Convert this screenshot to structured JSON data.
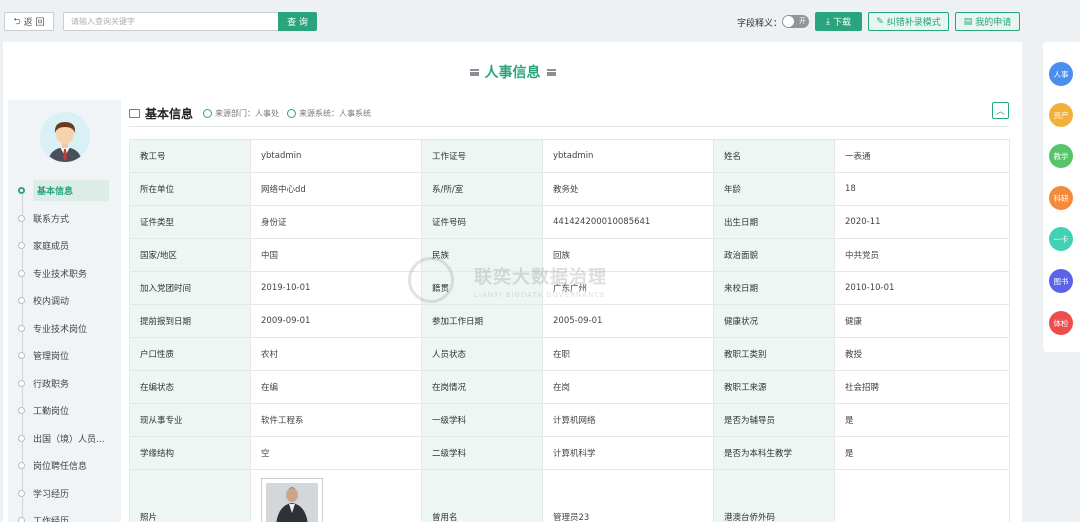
{
  "topbar": {
    "back_label": "返 回",
    "search_placeholder": "请输入查询关键字",
    "search_button": "查 询",
    "field_toggle_label": "字段释义：",
    "toggle_state": "开",
    "download_label": "下载",
    "correct_label": "纠错补录模式",
    "apply_label": "我的申请"
  },
  "page": {
    "title": "人事信息"
  },
  "section": {
    "title": "基本信息",
    "source_dept": "来源部门：人事处",
    "source_sys": "来源系统：人事系统"
  },
  "sidenav": {
    "items": [
      {
        "label": "基本信息",
        "active": true
      },
      {
        "label": "联系方式"
      },
      {
        "label": "家庭成员"
      },
      {
        "label": "专业技术职务"
      },
      {
        "label": "校内调动"
      },
      {
        "label": "专业技术岗位"
      },
      {
        "label": "管理岗位"
      },
      {
        "label": "行政职务"
      },
      {
        "label": "工勤岗位"
      },
      {
        "label": "出国（境）人员..."
      },
      {
        "label": "岗位聘任信息"
      },
      {
        "label": "学习经历"
      },
      {
        "label": "工作经历"
      }
    ]
  },
  "table": {
    "rows": [
      [
        "教工号",
        "ybtadmin",
        "工作证号",
        "ybtadmin",
        "姓名",
        "一表通"
      ],
      [
        "所在单位",
        "网络中心dd",
        "系/所/室",
        "教务处",
        "年龄",
        "18"
      ],
      [
        "证件类型",
        "身份证",
        "证件号码",
        "441424200010085641",
        "出生日期",
        "2020-11"
      ],
      [
        "国家/地区",
        "中国",
        "民族",
        "回族",
        "政治面貌",
        "中共党员"
      ],
      [
        "加入党团时间",
        "2019-10-01",
        "籍贯",
        "广东广州",
        "来校日期",
        "2010-10-01"
      ],
      [
        "提前报到日期",
        "2009-09-01",
        "参加工作日期",
        "2005-09-01",
        "健康状况",
        "健康"
      ],
      [
        "户口性质",
        "农村",
        "人员状态",
        "在职",
        "教职工类别",
        "教授"
      ],
      [
        "在编状态",
        "在编",
        "在岗情况",
        "在岗",
        "教职工来源",
        "社会招聘"
      ],
      [
        "现从事专业",
        "软件工程系",
        "一级学科",
        "计算机网络",
        "是否为辅导员",
        "是"
      ],
      [
        "学缘结构",
        "空",
        "二级学科",
        "计算机科学",
        "是否为本科生教学",
        "是"
      ]
    ],
    "photo_row": [
      "照片",
      "",
      "曾用名",
      "管理员23",
      "港澳台侨外码",
      ""
    ]
  },
  "watermark": {
    "title": "联奕大数据治理",
    "subtitle": "LIANYI BIGDATA GOVERNANCE"
  },
  "rightnav": {
    "items": [
      {
        "label": "人事",
        "color": "#4a8ef0"
      },
      {
        "label": "资产",
        "color": "#f2b03a"
      },
      {
        "label": "教学",
        "color": "#55c46a"
      },
      {
        "label": "科研",
        "color": "#f5893c"
      },
      {
        "label": "一卡",
        "color": "#41d1b3"
      },
      {
        "label": "图书",
        "color": "#5a64e8"
      },
      {
        "label": "体检",
        "color": "#ee4d4d"
      }
    ]
  },
  "colors": {
    "accent": "#2aa47d",
    "label_bg": "#eef6f3"
  }
}
